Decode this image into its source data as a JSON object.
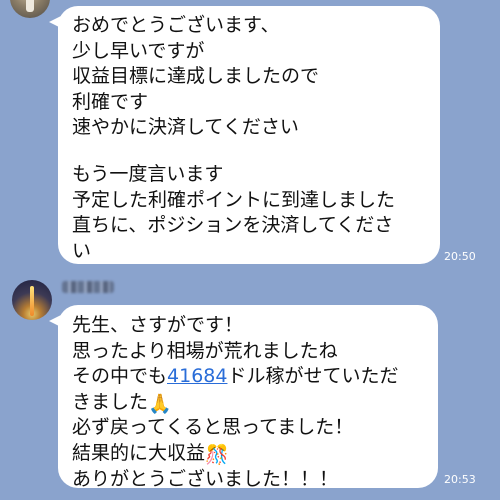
{
  "colors": {
    "chat_background": "#8aa3cd",
    "bubble_background": "#ffffff",
    "link": "#2a6dd8",
    "timestamp": "#ffffff"
  },
  "messages": [
    {
      "sender": "other-top",
      "avatar_icon": "deer-avatar-icon",
      "lines": [
        "おめでとうございます、",
        "少し早いですが",
        "収益目標に達成しましたので",
        "利確です",
        "速やかに決済してください",
        "",
        "もう一度言います",
        "予定した利確ポイントに到達しました",
        "直ちに、ポジションを決済してくださ",
        "い"
      ],
      "time": "20:50"
    },
    {
      "sender": "other-bottom",
      "avatar_icon": "tokyo-tower-avatar-icon",
      "sender_name_blurred": true,
      "lines": {
        "l1": "先生、さすがです！",
        "l2": "思ったより相場が荒れましたね",
        "l3_prefix": "その中でも",
        "l3_link": "41684",
        "l3_suffix": "ドル稼がせていただ",
        "l4": "きました",
        "l4_emoji": "🙏",
        "l5": "必ず戻ってくると思ってました！",
        "l6": "結果的に大収益",
        "l6_emoji": "🎊",
        "l7": "ありがとうございました！！！"
      },
      "time": "20:53"
    }
  ]
}
